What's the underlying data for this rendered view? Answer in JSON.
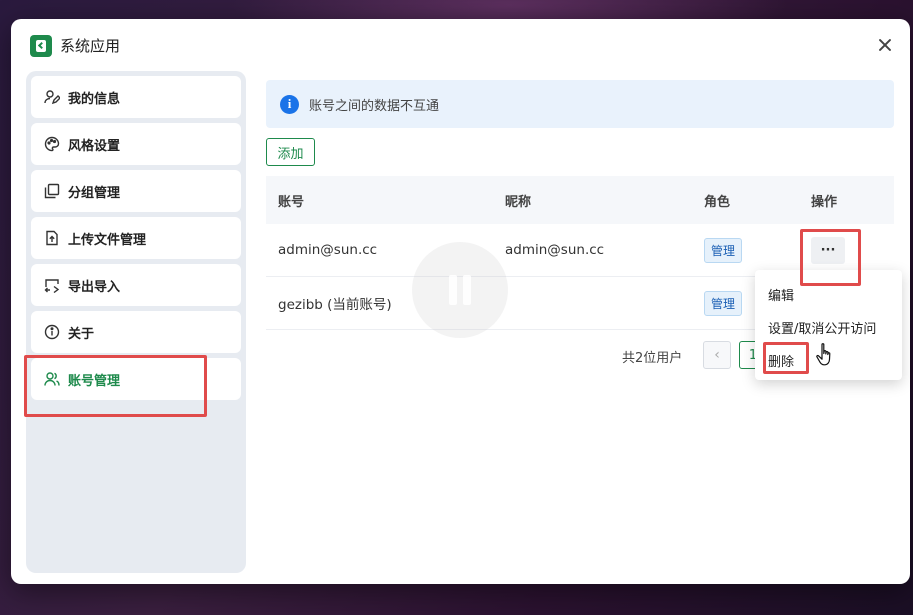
{
  "window": {
    "title": "系统应用",
    "icons": [
      "app-logo-icon",
      "close-icon"
    ]
  },
  "sidebar": {
    "items": [
      {
        "label": "我的信息",
        "icon": "user-edit-icon"
      },
      {
        "label": "风格设置",
        "icon": "palette-icon"
      },
      {
        "label": "分组管理",
        "icon": "copy-icon"
      },
      {
        "label": "上传文件管理",
        "icon": "file-upload-icon"
      },
      {
        "label": "导出导入",
        "icon": "export-import-icon"
      },
      {
        "label": "关于",
        "icon": "info-circle-icon"
      },
      {
        "label": "账号管理",
        "icon": "users-icon",
        "active": true
      }
    ]
  },
  "main": {
    "info_text": "账号之间的数据不互通",
    "add_label": "添加",
    "columns": [
      "账号",
      "昵称",
      "角色",
      "操作"
    ],
    "rows": [
      {
        "account": "admin@sun.cc",
        "nickname": "admin@sun.cc",
        "role": "管理",
        "action": "···"
      },
      {
        "account": "gezibb (当前账号)",
        "nickname": "",
        "role": "管理",
        "action": ""
      }
    ],
    "pager": {
      "total": "共2位用户",
      "prev": "‹",
      "page": "1"
    }
  },
  "dropdown": {
    "items": [
      "编辑",
      "设置/取消公开访问",
      "删除"
    ]
  },
  "colors": {
    "accent": "#1e8a4c",
    "highlight": "#e04b4b",
    "info_blue": "#1a73e8"
  }
}
